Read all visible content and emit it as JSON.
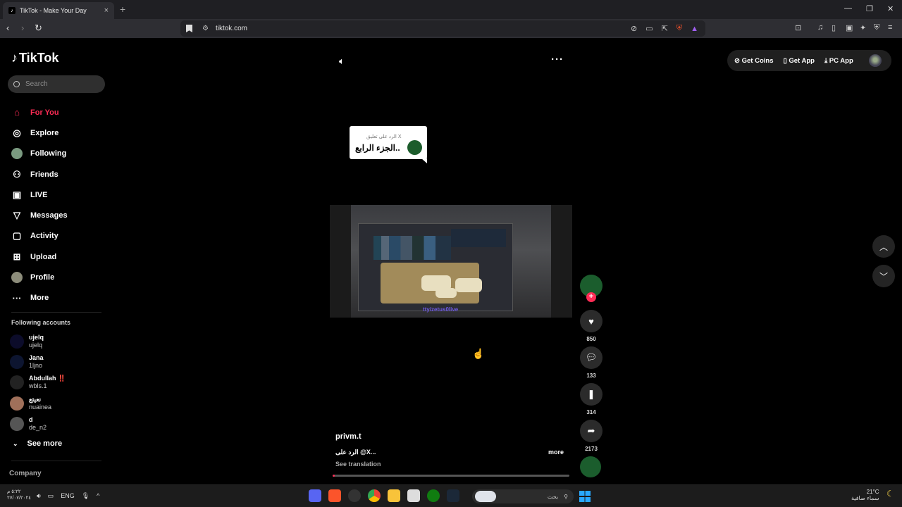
{
  "browser": {
    "tab_title": "TikTok - Make Your Day",
    "tab_close": "×",
    "new_tab": "+",
    "url": "tiktok.com"
  },
  "tiktok": {
    "logo_text": "TikTok",
    "search_placeholder": "Search",
    "nav": [
      {
        "label": "For You",
        "icon": "home-icon"
      },
      {
        "label": "Explore",
        "icon": "compass-icon"
      },
      {
        "label": "Following",
        "icon": "avatar-icon"
      },
      {
        "label": "Friends",
        "icon": "friends-icon"
      },
      {
        "label": "LIVE",
        "icon": "live-icon"
      },
      {
        "label": "Messages",
        "icon": "paper-plane-icon"
      },
      {
        "label": "Activity",
        "icon": "activity-icon"
      },
      {
        "label": "Upload",
        "icon": "plus-square-icon"
      },
      {
        "label": "Profile",
        "icon": "avatar-icon"
      },
      {
        "label": "More",
        "icon": "more-dots-icon"
      }
    ],
    "following_title": "Following accounts",
    "accounts": [
      {
        "name": "ujelq",
        "handle": "ujelq"
      },
      {
        "name": "Jana",
        "handle": "1ljno"
      },
      {
        "name": "Abdullah ‼️",
        "handle": "wbls.1"
      },
      {
        "name": "نعيتع",
        "handle": "nuainea"
      },
      {
        "name": "d",
        "handle": "de_n2"
      }
    ],
    "see_more": "See more",
    "company": "Company",
    "top_right": {
      "get_coins": "Get Coins",
      "get_app": "Get App",
      "pc_app": "PC App"
    },
    "video": {
      "bubble_sub": "الرد على تعليق X",
      "bubble_main": "الجزء الرابع..",
      "watermark_url": "tty/zetus0live",
      "author": "privm.t",
      "caption": "الرد على @X...",
      "more": "more",
      "see_translation": "See translation",
      "progress": 0.01
    },
    "actions": {
      "likes": "850",
      "comments": "133",
      "saves": "314",
      "shares": "2173"
    }
  },
  "taskbar": {
    "time": "٥:٢٢ م",
    "date": "٢٧/٠٧/٢٠٢٤",
    "lang": "ENG",
    "search_text": "بحث",
    "temp": "21°C",
    "weather": "سماء صافية"
  },
  "colors": {
    "accent": "#fe2c55",
    "background": "#000000"
  }
}
